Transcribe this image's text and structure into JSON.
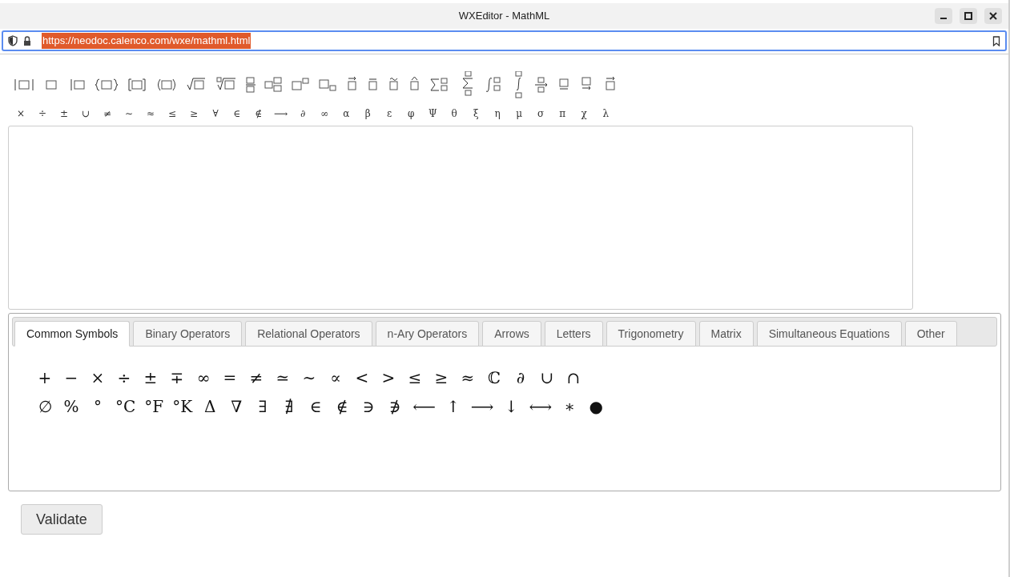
{
  "window": {
    "title": "WXEditor - MathML"
  },
  "address_bar": {
    "url": "https://neodoc.calenco.com/wxe/mathml.html",
    "url_selected": true
  },
  "quick_symbols": [
    "×",
    "÷",
    "±",
    "∪",
    "≠",
    "∼",
    "≈",
    "≤",
    "≥",
    "∀",
    "∈",
    "∉",
    "⟶",
    "∂",
    "∞",
    "α",
    "β",
    "ε",
    "φ",
    "Ψ",
    "θ",
    "ξ",
    "η",
    "μ",
    "σ",
    "π",
    "χ",
    "λ"
  ],
  "tabs": [
    {
      "label": "Common Symbols",
      "selected": true
    },
    {
      "label": "Binary Operators",
      "selected": false
    },
    {
      "label": "Relational Operators",
      "selected": false
    },
    {
      "label": "n-Ary Operators",
      "selected": false
    },
    {
      "label": "Arrows",
      "selected": false
    },
    {
      "label": "Letters",
      "selected": false
    },
    {
      "label": "Trigonometry",
      "selected": false
    },
    {
      "label": "Matrix",
      "selected": false
    },
    {
      "label": "Simultaneous Equations",
      "selected": false
    },
    {
      "label": "Other",
      "selected": false
    }
  ],
  "symbol_rows": [
    [
      "+",
      "−",
      "×",
      "÷",
      "±",
      "∓",
      "∞",
      "=",
      "≠",
      "≃",
      "∼",
      "∝",
      "<",
      ">",
      "≤",
      "≥",
      "≈",
      "ℂ",
      "∂",
      "∪",
      "∩"
    ],
    [
      "∅",
      "%",
      "°",
      "°C",
      "°F",
      "°K",
      "Δ",
      "∇",
      "∃",
      "∄",
      "∈",
      "∉",
      "∋",
      "∌",
      "⟵",
      "↑",
      "⟶",
      "↓",
      "⟷",
      "∗",
      "●"
    ]
  ],
  "validate_button": "Validate"
}
